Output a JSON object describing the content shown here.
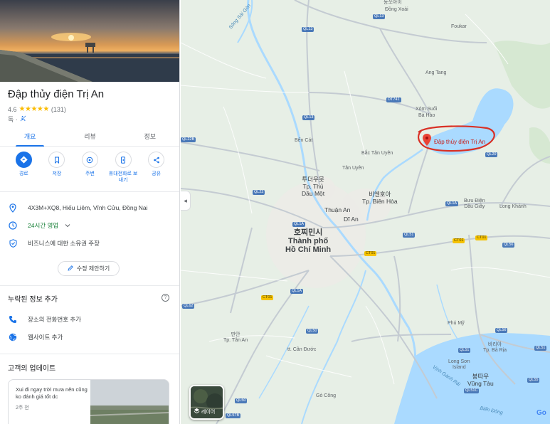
{
  "place": {
    "title": "Đập thủy điện Trị An",
    "rating": "4.6",
    "stars": "★★★★★",
    "review_count": "(131)",
    "category": "독 ·"
  },
  "tabs": [
    {
      "label": "개요"
    },
    {
      "label": "리뷰"
    },
    {
      "label": "정보"
    }
  ],
  "actions": [
    {
      "label": "경로",
      "icon": "directions-icon"
    },
    {
      "label": "저장",
      "icon": "bookmark-icon"
    },
    {
      "label": "주변",
      "icon": "nearby-icon"
    },
    {
      "label": "휴대전화로 보내기",
      "icon": "send-to-phone-icon"
    },
    {
      "label": "공유",
      "icon": "share-icon"
    }
  ],
  "info": {
    "address": "4X3M+XQ8, Hiếu Liêm, Vĩnh Cửu, Đồng Nai",
    "hours": "24시간 영업",
    "claim": "비즈니스에 대한 소유권 주장",
    "suggest_edit": "수정 제안하기"
  },
  "missing_info": {
    "title": "누락된 정보 추가",
    "help": "?",
    "add_phone": "장소의 전화번호 추가",
    "add_website": "웹사이트 추가"
  },
  "updates": {
    "title": "고객의 업데이트",
    "card_text": "Xui đi ngay trời mưa nên cũng ko đánh giá tốt dc",
    "card_time": "2주 전"
  },
  "map": {
    "collapse": "◂",
    "pin_label": "Đập thủy điện Trị An",
    "layers_label": "레이어",
    "google": "Go",
    "colors": {
      "water": "#aadaff",
      "road": "#ffffff",
      "pin": "#ea4335",
      "annotation": "#d93025"
    },
    "labels": {
      "dong_xoai": "Đồng Xoài",
      "dong_xoai_kr": "동쏘아이",
      "foukar": "Foukar",
      "ang_tang": "Ang Tang",
      "xom_suoi": "Xóm Suối",
      "ba_hao": "Bà Hào",
      "song_sai_gon": "Sông Sài Gòn",
      "ben_cat": "Bến Cát",
      "bac_tan_uyen": "Bắc Tân Uyên",
      "tan_uyen": "Tân Uyên",
      "thu_dau_mot": "투더우못\nTp. Thủ\nDầu Một",
      "bien_hoa": "비엔호아\nTp. Biên Hòa",
      "thuan_an": "Thuận An",
      "di_an": "Dĩ An",
      "hcm": "호찌민시\nThành phố\nHồ Chí Minh",
      "buu_dien": "Bưu Điện\nDầu Giây",
      "long_khanh": "Long Khánh",
      "tan_an": "딴안\nTp. Tân An",
      "can_duoc": "tt. Cần Đước",
      "go_cong": "Gò Công",
      "phu_my": "Phú Mỹ",
      "ba_ria": "바리아\nTp. Bà Rịa",
      "long_son": "Long Sơn\nIsland",
      "vung_tau": "붕따우\nVũng Tàu",
      "ganh_rai": "Vịnh Gành Rái",
      "bien_dong": "Biển Đông"
    },
    "shields": [
      "QL13",
      "QL13",
      "QL13",
      "DT741",
      "QL22B",
      "QL22",
      "QL20",
      "QL1A",
      "QL1A",
      "QL1A",
      "QL51",
      "QL56",
      "CT01",
      "CT01",
      "CT01",
      "CT01",
      "QL62",
      "QL50",
      "QL50",
      "QL51",
      "QL51",
      "QL56",
      "QL55",
      "QL51C",
      "QL57B"
    ]
  }
}
